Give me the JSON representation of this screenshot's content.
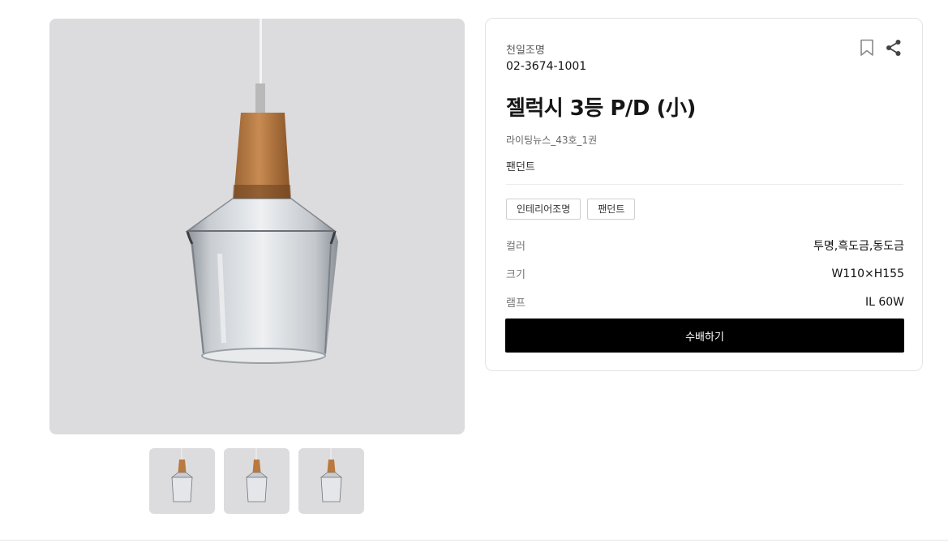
{
  "gallery": {
    "main_image": "pendant-lamp-photo",
    "thumbnails": [
      "pendant-lamp-photo",
      "pendant-lamp-photo",
      "pendant-lamp-photo"
    ]
  },
  "product": {
    "brand": "천일조명",
    "phone": "02-3674-1001",
    "title": "젤럭시 3등 P/D (小)",
    "source": "라이팅뉴스_43호_1권",
    "category": "팬던트",
    "tags": [
      "인테리어조명",
      "팬던트"
    ],
    "specs": [
      {
        "label": "컬러",
        "value": "투명,흑도금,동도금"
      },
      {
        "label": "크기",
        "value": "W110×H155"
      },
      {
        "label": "램프",
        "value": "IL 60W"
      }
    ],
    "order_label": "수배하기"
  },
  "icons": {
    "bookmark": "bookmark-icon",
    "share": "share-icon"
  }
}
